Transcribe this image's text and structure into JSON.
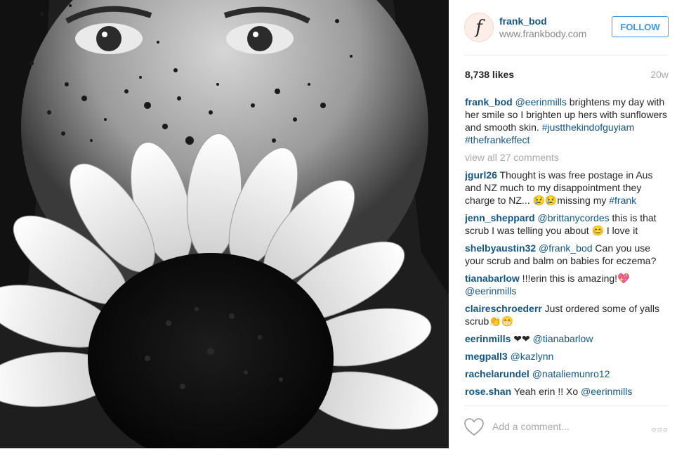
{
  "post": {
    "username": "frank_bod",
    "website": "www.frankbody.com",
    "follow_label": "FOLLOW",
    "avatar_letter": "f",
    "likes": "8,738 likes",
    "time_ago": "20w"
  },
  "caption": {
    "user": "frank_bod",
    "mention": "@eerinmills",
    "text": " brightens my day with her smile so I brighten up hers with sunflowers and smooth skin. ",
    "tags": "#justthekindofguyiam #thefrankeffect"
  },
  "view_all": "view all 27 comments",
  "comments": [
    {
      "user": "jgurl26",
      "pre": " Thought is was free postage in Aus and NZ much to my disappointment they charge to NZ... 😢😢missing my ",
      "mention": "#frank",
      "post": ""
    },
    {
      "user": "jenn_sheppard",
      "pre": " ",
      "mention": "@brittanycordes",
      "post": " this is that scrub I was telling you about 😊 I love it"
    },
    {
      "user": "shelbyaustin32",
      "pre": " ",
      "mention": "@frank_bod",
      "post": " Can you use your scrub and balm on babies for eczema?"
    },
    {
      "user": "tianabarlow",
      "pre": " !!!erin this is amazing!💖 ",
      "mention": "@eerinmills",
      "post": ""
    },
    {
      "user": "claireschroederr",
      "pre": " Just ordered some of yalls scrub👏😁",
      "mention": "",
      "post": ""
    },
    {
      "user": "eerinmills",
      "pre": " ❤❤ ",
      "mention": "@tianabarlow",
      "post": ""
    },
    {
      "user": "megpall3",
      "pre": " ",
      "mention": "@kazlynn",
      "post": ""
    },
    {
      "user": "rachelarundel",
      "pre": " ",
      "mention": "@nataliemunro12",
      "post": ""
    },
    {
      "user": "rose.shan",
      "pre": " Yeah erin !! Xo ",
      "mention": "@eerinmills",
      "post": ""
    }
  ],
  "footer": {
    "add_comment_placeholder": "Add a comment...",
    "more_label": "○○○"
  },
  "icons": {
    "heart": "heart-icon",
    "more": "more-options-icon"
  },
  "colors": {
    "link": "#125688",
    "follow": "#3897f0",
    "muted": "#a5a7aa"
  }
}
